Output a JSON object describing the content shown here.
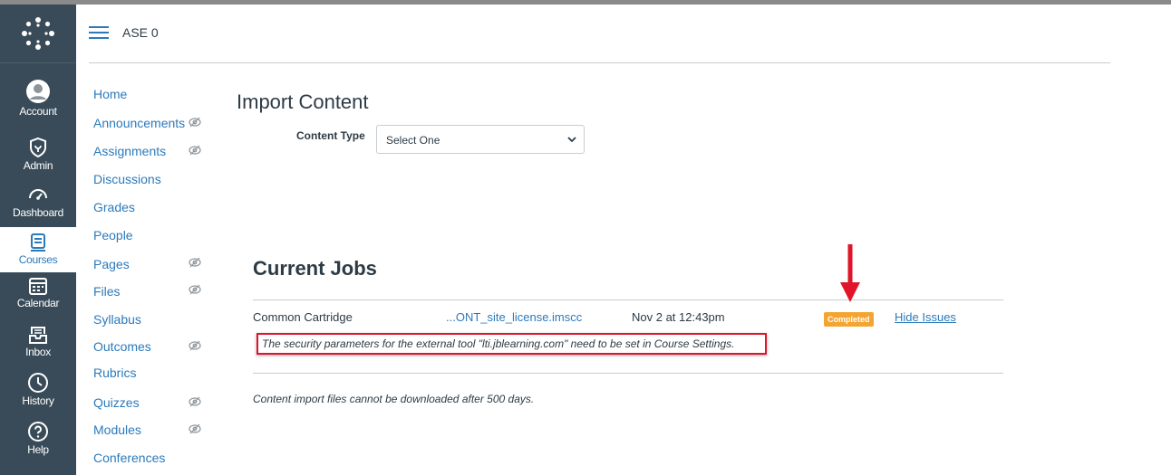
{
  "header": {
    "breadcrumb": "ASE 0"
  },
  "global_nav": [
    {
      "label": "Account",
      "icon": "account-icon"
    },
    {
      "label": "Admin",
      "icon": "shield-icon"
    },
    {
      "label": "Dashboard",
      "icon": "dashboard-icon"
    },
    {
      "label": "Courses",
      "icon": "courses-icon",
      "active": true
    },
    {
      "label": "Calendar",
      "icon": "calendar-icon"
    },
    {
      "label": "Inbox",
      "icon": "inbox-icon"
    },
    {
      "label": "History",
      "icon": "history-icon"
    },
    {
      "label": "Help",
      "icon": "help-icon"
    }
  ],
  "course_nav": [
    {
      "label": "Home",
      "hidden": false
    },
    {
      "label": "Announcements",
      "hidden": true
    },
    {
      "label": "Assignments",
      "hidden": true
    },
    {
      "label": "Discussions",
      "hidden": false
    },
    {
      "label": "Grades",
      "hidden": false
    },
    {
      "label": "People",
      "hidden": false
    },
    {
      "label": "Pages",
      "hidden": true
    },
    {
      "label": "Files",
      "hidden": true
    },
    {
      "label": "Syllabus",
      "hidden": false
    },
    {
      "label": "Outcomes",
      "hidden": true
    },
    {
      "label": "Rubrics",
      "hidden": false
    },
    {
      "label": "Quizzes",
      "hidden": true
    },
    {
      "label": "Modules",
      "hidden": true
    },
    {
      "label": "Conferences",
      "hidden": false
    }
  ],
  "main": {
    "title": "Import Content",
    "content_type_label": "Content Type",
    "content_type_value": "Select One",
    "jobs_title": "Current Jobs",
    "job": {
      "type": "Common Cartridge",
      "file": "...ONT_site_license.imscc",
      "date": "Nov 2 at 12:43pm",
      "status": "Completed",
      "action": "Hide Issues",
      "issue": "The security parameters for the external tool \"lti.jblearning.com\" need to be set in Course Settings."
    },
    "footnote": "Content import files cannot be downloaded after 500 days."
  },
  "colors": {
    "nav_bg": "#394b58",
    "link": "#2b7abc",
    "badge": "#f4a430",
    "annotation_red": "#e0152a"
  }
}
